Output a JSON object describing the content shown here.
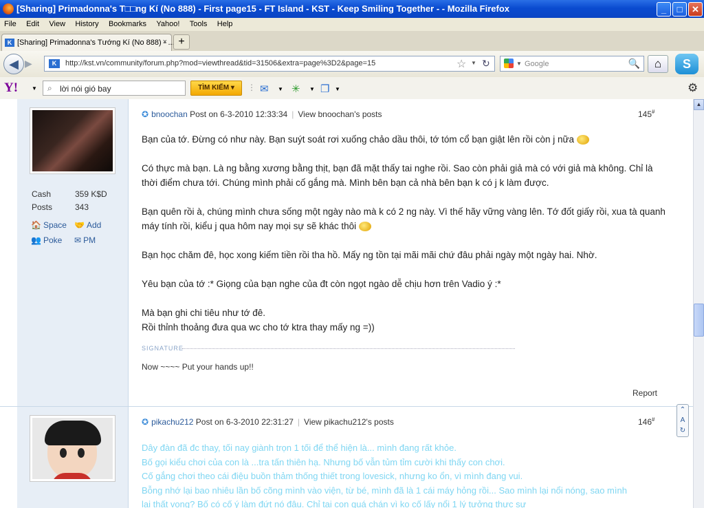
{
  "window": {
    "title": "[Sharing] Primadonna's T□□ng Kí (No 888) - First page15 - FT Island - KST - Keep Smiling Together - - Mozilla Firefox"
  },
  "menu": [
    "File",
    "Edit",
    "View",
    "History",
    "Bookmarks",
    "Yahoo!",
    "Tools",
    "Help"
  ],
  "tab": {
    "label": "[Sharing] Primadonna's Tướng Kí (No 888) - ...",
    "close": "×",
    "new": "+"
  },
  "nav": {
    "url": "http://kst.vn/community/forum.php?mod=viewthread&tid=31506&extra=page%3D2&page=15",
    "search_placeholder": "Google"
  },
  "yahoo": {
    "logo": "Y!",
    "search_value": "lời nói gió bay",
    "button": "TÌM KIẾM"
  },
  "post1": {
    "username": "bnoochan",
    "posted": "Post on 6-3-2010 12:33:34",
    "view_posts": "View bnoochan's posts",
    "number": "145",
    "sup": "#",
    "stats": [
      {
        "label": "Cash",
        "value": "359 K$D"
      },
      {
        "label": "Posts",
        "value": "343"
      }
    ],
    "links": {
      "space": "Space",
      "add": "Add",
      "poke": "Poke",
      "pm": "PM"
    },
    "paragraphs": [
      "Bạn của tớ. Đừng có như này. Bạn suýt soát rơi xuống chảo dầu thôi, tớ tóm cổ bạn giật lên rồi còn j nữa",
      "Có thực mà bạn. Là ng bằng xương bằng thịt, bạn đã mặt thấy tai nghe rồi. Sao còn phải giả mà có với giả mà không. Chỉ là thời điểm chưa tới. Chúng mình phải cố gắng mà. Mình bên bạn cả nhà bên bạn k có j k làm được.",
      "Bạn quên rồi à, chúng mình chưa sống một ngày nào mà k có 2 ng này. Vì thế hãy vững vàng lên. Tớ đốt giấy rồi, xua tà quanh máy tính rồi, kiểu j qua hôm nay mọi sự sẽ khác thôi",
      "Bạn học chăm đê, học xong kiếm tiền rồi tha hồ. Mấy ng tồn tại mãi mãi chứ đâu phải ngày một ngày hai. Nhờ.",
      "Yêu bạn của tớ :* Giọng của bạn nghe của đt còn ngọt ngào dễ chịu hơn trên Vadio ý :*"
    ],
    "last_lines": [
      "Mà bạn ghi chi tiêu như tớ đê.",
      "Rồi thỉnh thoảng đưa qua wc cho tớ ktra thay mấy ng =))"
    ],
    "signature_label": "SIGNATURE",
    "signature": "Now ~~~~ Put your hands up!!",
    "report": "Report"
  },
  "post2": {
    "username": "pikachu212",
    "posted": "Post on 6-3-2010 22:31:27",
    "view_posts": "View pikachu212's posts",
    "number": "146",
    "sup": "#",
    "lines": [
      "Dây đàn đã đc thay, tối nay giành trọn 1 tối để thể hiện là... mình đang rất khỏe.",
      "Bố gọi kiểu chơi của con là ...tra tấn thiên hạ. Nhưng bố vẫn tủm tỉm cười khi thấy con chơi.",
      "Cố gắng chơi theo cái điệu buồn thảm thống thiết trong lovesick, nhưng ko ổn, vì mình đang vui.",
      "Bỗng nhớ lại bao nhiêu lần bố cõng mình vào viện, từ bé, mình đã là 1 cái máy hỏng rồi... Sao mình lại nổi nóng, sao mình",
      "lại thất vọng? Bố có cố ý làm đứt nó đâu. Chỉ tại con quá chán vì ko cố lấy nổi 1 lý tưởng thực sự"
    ]
  }
}
